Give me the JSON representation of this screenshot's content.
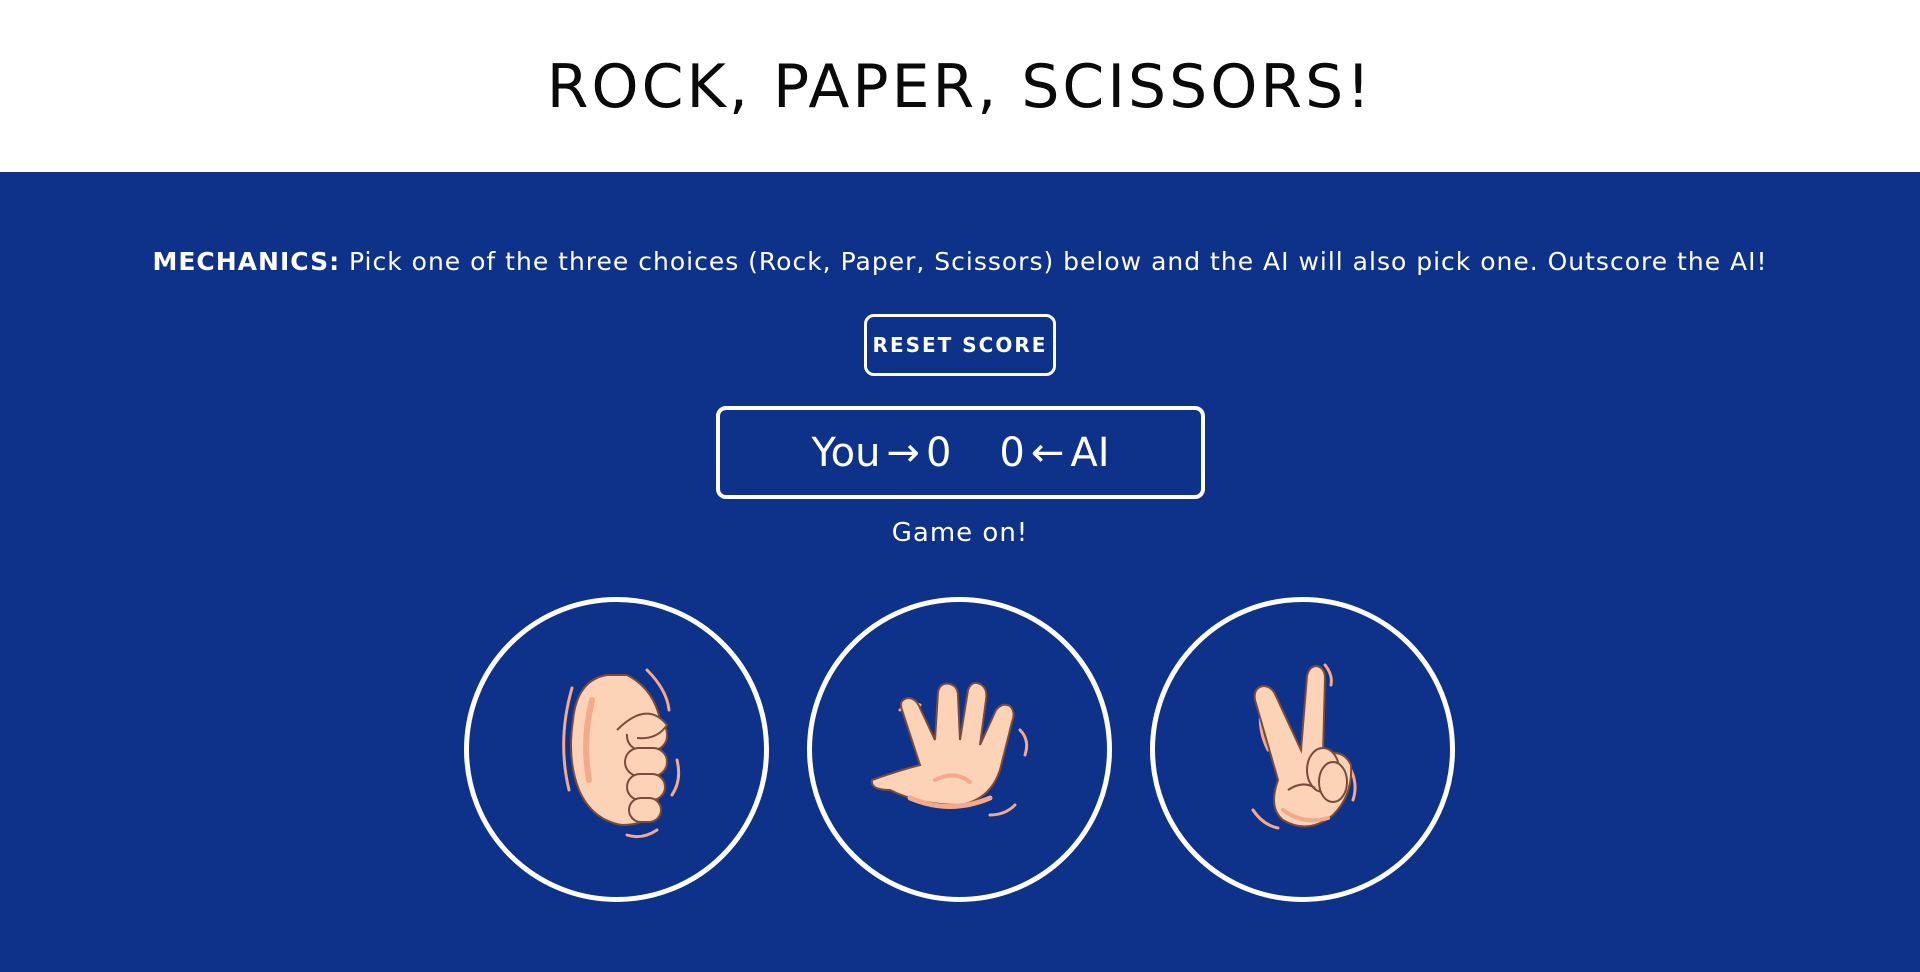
{
  "header": {
    "title": "ROCK, PAPER, SCISSORS!"
  },
  "mechanics": {
    "label": "MECHANICS:",
    "text": " Pick one of the three choices (Rock, Paper, Scissors) below and the AI will also pick one. Outscore the AI!"
  },
  "controls": {
    "reset_label": "RESET SCORE"
  },
  "score": {
    "player_label": "You",
    "player_arrow": "→",
    "player_score": "0",
    "ai_score": "0",
    "ai_arrow": "←",
    "ai_label": "AI"
  },
  "status": {
    "message": "Game on!"
  },
  "choices": [
    {
      "name": "Rock",
      "icon": "fist-hand-icon"
    },
    {
      "name": "Paper",
      "icon": "open-hand-icon"
    },
    {
      "name": "Scissors",
      "icon": "peace-sign-hand-icon"
    }
  ],
  "colors": {
    "background": "#0e3289",
    "header_background": "#ffffff",
    "foreground": "#ffffff",
    "skin": "#fcd3b6",
    "skin_shadow": "#f4a98a",
    "outline": "#7a4a3a"
  }
}
